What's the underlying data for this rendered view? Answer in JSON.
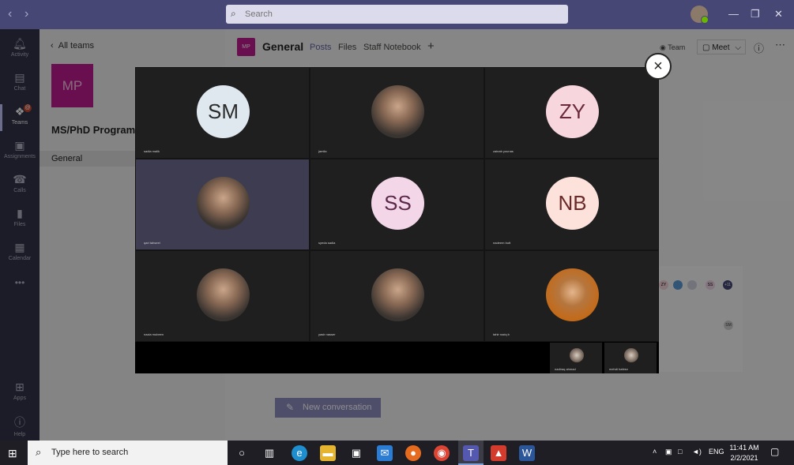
{
  "titlebar": {
    "search_placeholder": "Search",
    "back_icon": "chevron-left-icon",
    "forward_icon": "chevron-right-icon"
  },
  "rail": {
    "items": [
      {
        "label": "Activity",
        "icon": "bell-icon"
      },
      {
        "label": "Chat",
        "icon": "chat-icon"
      },
      {
        "label": "Teams",
        "icon": "teams-icon",
        "badge": "@"
      },
      {
        "label": "Assignments",
        "icon": "assignments-icon"
      },
      {
        "label": "Calls",
        "icon": "phone-icon"
      },
      {
        "label": "Files",
        "icon": "file-icon"
      },
      {
        "label": "Calendar",
        "icon": "calendar-icon"
      },
      {
        "label": "•••",
        "icon": "more-icon"
      }
    ],
    "bottom_items": [
      {
        "label": "Apps",
        "icon": "apps-icon"
      },
      {
        "label": "Help",
        "icon": "help-icon"
      }
    ]
  },
  "sidepanel": {
    "back_label": "All teams",
    "team_initials": "MP",
    "team_name": "MS/PhD Program",
    "channel": "General"
  },
  "channel_header": {
    "logo": "MP",
    "title": "General",
    "tabs": [
      "Posts",
      "Files",
      "Staff Notebook"
    ],
    "add_tab": "+",
    "team_label": "Team",
    "meet_label": "Meet",
    "meet_chevron": "⌵"
  },
  "main": {
    "new_conversation": "New conversation",
    "reactions": [
      {
        "text": "ZY",
        "color": "#f6d3dc"
      },
      {
        "text": "",
        "color": "#5b9bd5"
      },
      {
        "text": "",
        "color": "#cfd1e0"
      },
      {
        "text": "SS",
        "color": "#f1d3e6"
      },
      {
        "text": "+11",
        "color": "#464775"
      }
    ],
    "reply_avatar": "SM"
  },
  "meeting": {
    "tiles": [
      {
        "initials": "SM",
        "name": "sadia malik",
        "bg": "#dfe8ef",
        "fg": "#2b2b2b",
        "photo": false
      },
      {
        "initials": "",
        "name": "jamila",
        "bg": "",
        "fg": "",
        "photo": true
      },
      {
        "initials": "ZY",
        "name": "zainab younas",
        "bg": "#f7d6de",
        "fg": "#6b2a3b",
        "photo": false
      },
      {
        "initials": "",
        "name": "qari tahseel",
        "bg": "",
        "fg": "",
        "photo": true,
        "highlight": true
      },
      {
        "initials": "SS",
        "name": "syeda sadia",
        "bg": "#f3d6e8",
        "fg": "#5b2a4a",
        "photo": false
      },
      {
        "initials": "NB",
        "name": "nadeem butt",
        "bg": "#fde2dc",
        "fg": "#6b2a2a",
        "photo": false
      },
      {
        "initials": "",
        "name": "nazia mubeen",
        "bg": "",
        "fg": "",
        "photo": true
      },
      {
        "initials": "",
        "name": "yasir nasser",
        "bg": "",
        "fg": "",
        "photo": true
      },
      {
        "initials": "",
        "name": "tahir raziq b",
        "bg": "",
        "fg": "",
        "photo": true
      }
    ],
    "strip": [
      {
        "name": "nadiraq ahmad"
      },
      {
        "name": "mehdi hafeez"
      }
    ],
    "close_label": "×"
  },
  "taskbar": {
    "search_placeholder": "Type here to search",
    "lang": "ENG",
    "time": "11:41 AM",
    "date": "2/2/2021"
  }
}
